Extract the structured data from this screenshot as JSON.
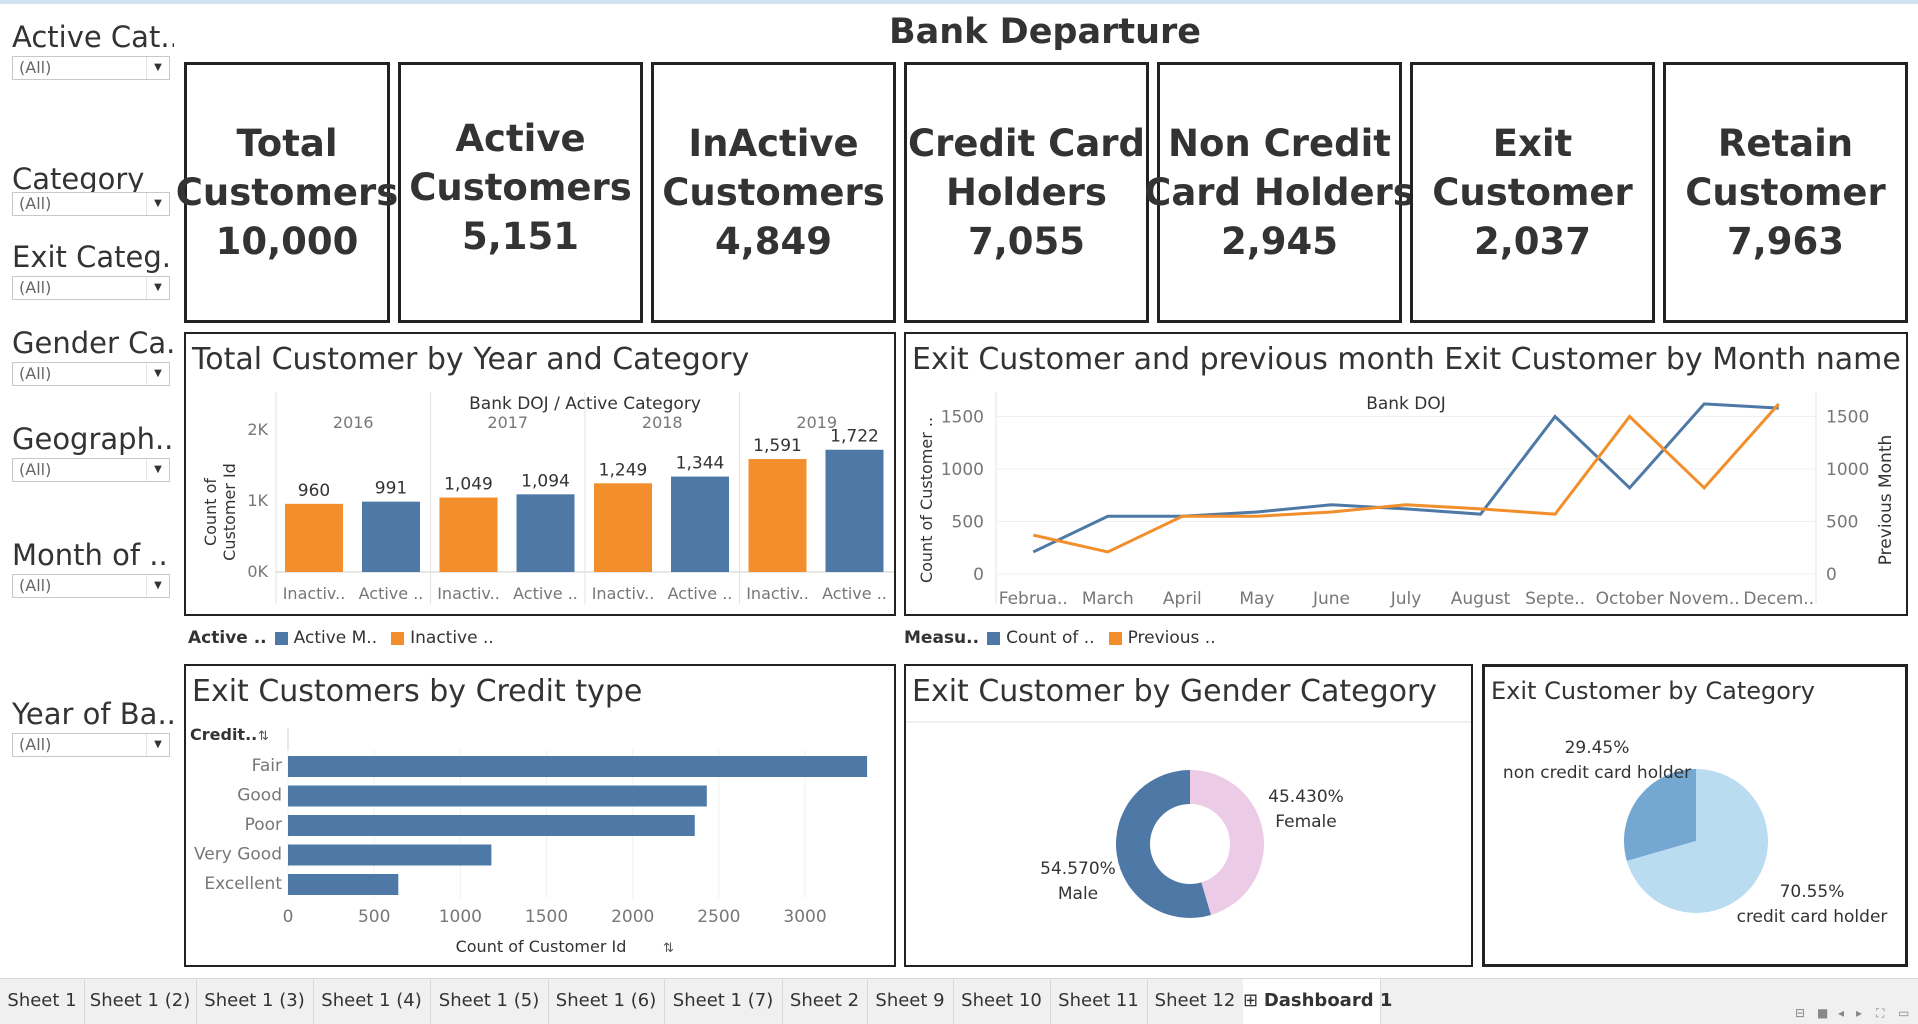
{
  "dashboard": {
    "title": "Bank Departure"
  },
  "filters": [
    {
      "title": "Active Cat..",
      "value": "(All)"
    },
    {
      "title": "Category",
      "value": "(All)"
    },
    {
      "title": "Exit Categ..",
      "value": "(All)"
    },
    {
      "title": "Gender Ca..",
      "value": "(All)"
    },
    {
      "title": "Geograph..",
      "value": "(All)"
    },
    {
      "title": "Month of ..",
      "value": "(All)"
    },
    {
      "title": "Year of Ba..",
      "value": "(All)"
    }
  ],
  "kpis": [
    {
      "line1": "Total",
      "line2": "Customers",
      "value": "10,000"
    },
    {
      "line1": "Active",
      "line2": "Customers",
      "value": "5,151"
    },
    {
      "line1": "InActive",
      "line2": "Customers",
      "value": "4,849"
    },
    {
      "line1": "Credit Card",
      "line2": "Holders",
      "value": "7,055"
    },
    {
      "line1": "Non Credit",
      "line2": "Card Holders",
      "value": "2,945"
    },
    {
      "line1": "Exit",
      "line2": "Customer",
      "value": "2,037"
    },
    {
      "line1": "Retain",
      "line2": "Customer",
      "value": "7,963"
    }
  ],
  "colors": {
    "blue": "#4e79a7",
    "orange": "#f28e2b",
    "pink": "#eccbe6",
    "light_blue": "#b9dcf1",
    "mid_blue": "#74a7d1"
  },
  "panels": {
    "year_category": {
      "title": "Total Customer by Year and Category",
      "legend_title": "Active ..",
      "legend": [
        {
          "label": "Active M..",
          "color": "#4e79a7"
        },
        {
          "label": "Inactive ..",
          "color": "#f28e2b"
        }
      ]
    },
    "exit_month": {
      "title": "Exit Customer and previous month Exit Customer by Month name",
      "legend_title": "Measu..",
      "legend": [
        {
          "label": "Count of ..",
          "color": "#4e79a7"
        },
        {
          "label": "Previous ..",
          "color": "#f28e2b"
        }
      ]
    },
    "credit_type": {
      "title": "Exit Customers by Credit type"
    },
    "gender": {
      "title": "Exit Customer by Gender Category"
    },
    "category": {
      "title": "Exit Customer by Category"
    }
  },
  "chart_data": [
    {
      "id": "year_category",
      "type": "bar",
      "header": "Bank DOJ  /  Active Category",
      "years": [
        "2016",
        "2017",
        "2018",
        "2019"
      ],
      "categories": [
        "Inactiv..",
        "Active .."
      ],
      "ylabel": "Count of Customer Id",
      "yticks": [
        "0K",
        "1K",
        "2K"
      ],
      "ylim": [
        0,
        2000
      ],
      "values": [
        [
          960,
          991
        ],
        [
          1049,
          1094
        ],
        [
          1249,
          1344
        ],
        [
          1591,
          1722
        ]
      ],
      "value_labels": [
        [
          "960",
          "991"
        ],
        [
          "1,049",
          "1,094"
        ],
        [
          "1,249",
          "1,344"
        ],
        [
          "1,591",
          "1,722"
        ]
      ]
    },
    {
      "id": "exit_month",
      "type": "line",
      "header": "Bank DOJ",
      "x": [
        "Februa..",
        "March",
        "April",
        "May",
        "June",
        "July",
        "August",
        "Septe..",
        "October",
        "Novem..",
        "Decem.."
      ],
      "ylabel_left": "Count of Customer ..",
      "ylabel_right": "Previous Month",
      "yticks": [
        "0",
        "500",
        "1000",
        "1500"
      ],
      "ylim": [
        0,
        1600
      ],
      "series": [
        {
          "name": "Count of ..",
          "values": [
            210,
            550,
            550,
            590,
            660,
            620,
            570,
            1500,
            820,
            1620,
            1580
          ]
        },
        {
          "name": "Previous ..",
          "values": [
            370,
            210,
            550,
            550,
            590,
            660,
            620,
            570,
            1500,
            820,
            1620
          ]
        }
      ]
    },
    {
      "id": "credit_type",
      "type": "bar",
      "orientation": "horizontal",
      "header": "Credit..",
      "categories": [
        "Fair",
        "Good",
        "Poor",
        "Very Good",
        "Excellent"
      ],
      "values": [
        3360,
        2430,
        2360,
        1180,
        640
      ],
      "xlabel": "Count of Customer Id",
      "xticks": [
        "0",
        "500",
        "1000",
        "1500",
        "2000",
        "2500",
        "3000"
      ],
      "xlim": [
        0,
        3400
      ]
    },
    {
      "id": "gender",
      "type": "pie",
      "donut": true,
      "slices": [
        {
          "label": "Female",
          "pct_label": "45.430%",
          "value": 45.43,
          "color": "#eccbe6"
        },
        {
          "label": "Male",
          "pct_label": "54.570%",
          "value": 54.57,
          "color": "#4e79a7"
        }
      ]
    },
    {
      "id": "category",
      "type": "pie",
      "slices": [
        {
          "label": "non credit card holder",
          "pct_label": "29.45%",
          "value": 29.45,
          "color": "#74a7d1"
        },
        {
          "label": "credit card holder",
          "pct_label": "70.55%",
          "value": 70.55,
          "color": "#b9dcf1"
        }
      ]
    }
  ],
  "tabs": [
    "Sheet 1",
    "Sheet 1 (2)",
    "Sheet 1 (3)",
    "Sheet 1 (4)",
    "Sheet 1 (5)",
    "Sheet 1 (6)",
    "Sheet 1 (7)",
    "Sheet 2",
    "Sheet 9",
    "Sheet 10",
    "Sheet 11",
    "Sheet 12",
    "Dashboard 1"
  ],
  "active_tab": "Dashboard 1"
}
